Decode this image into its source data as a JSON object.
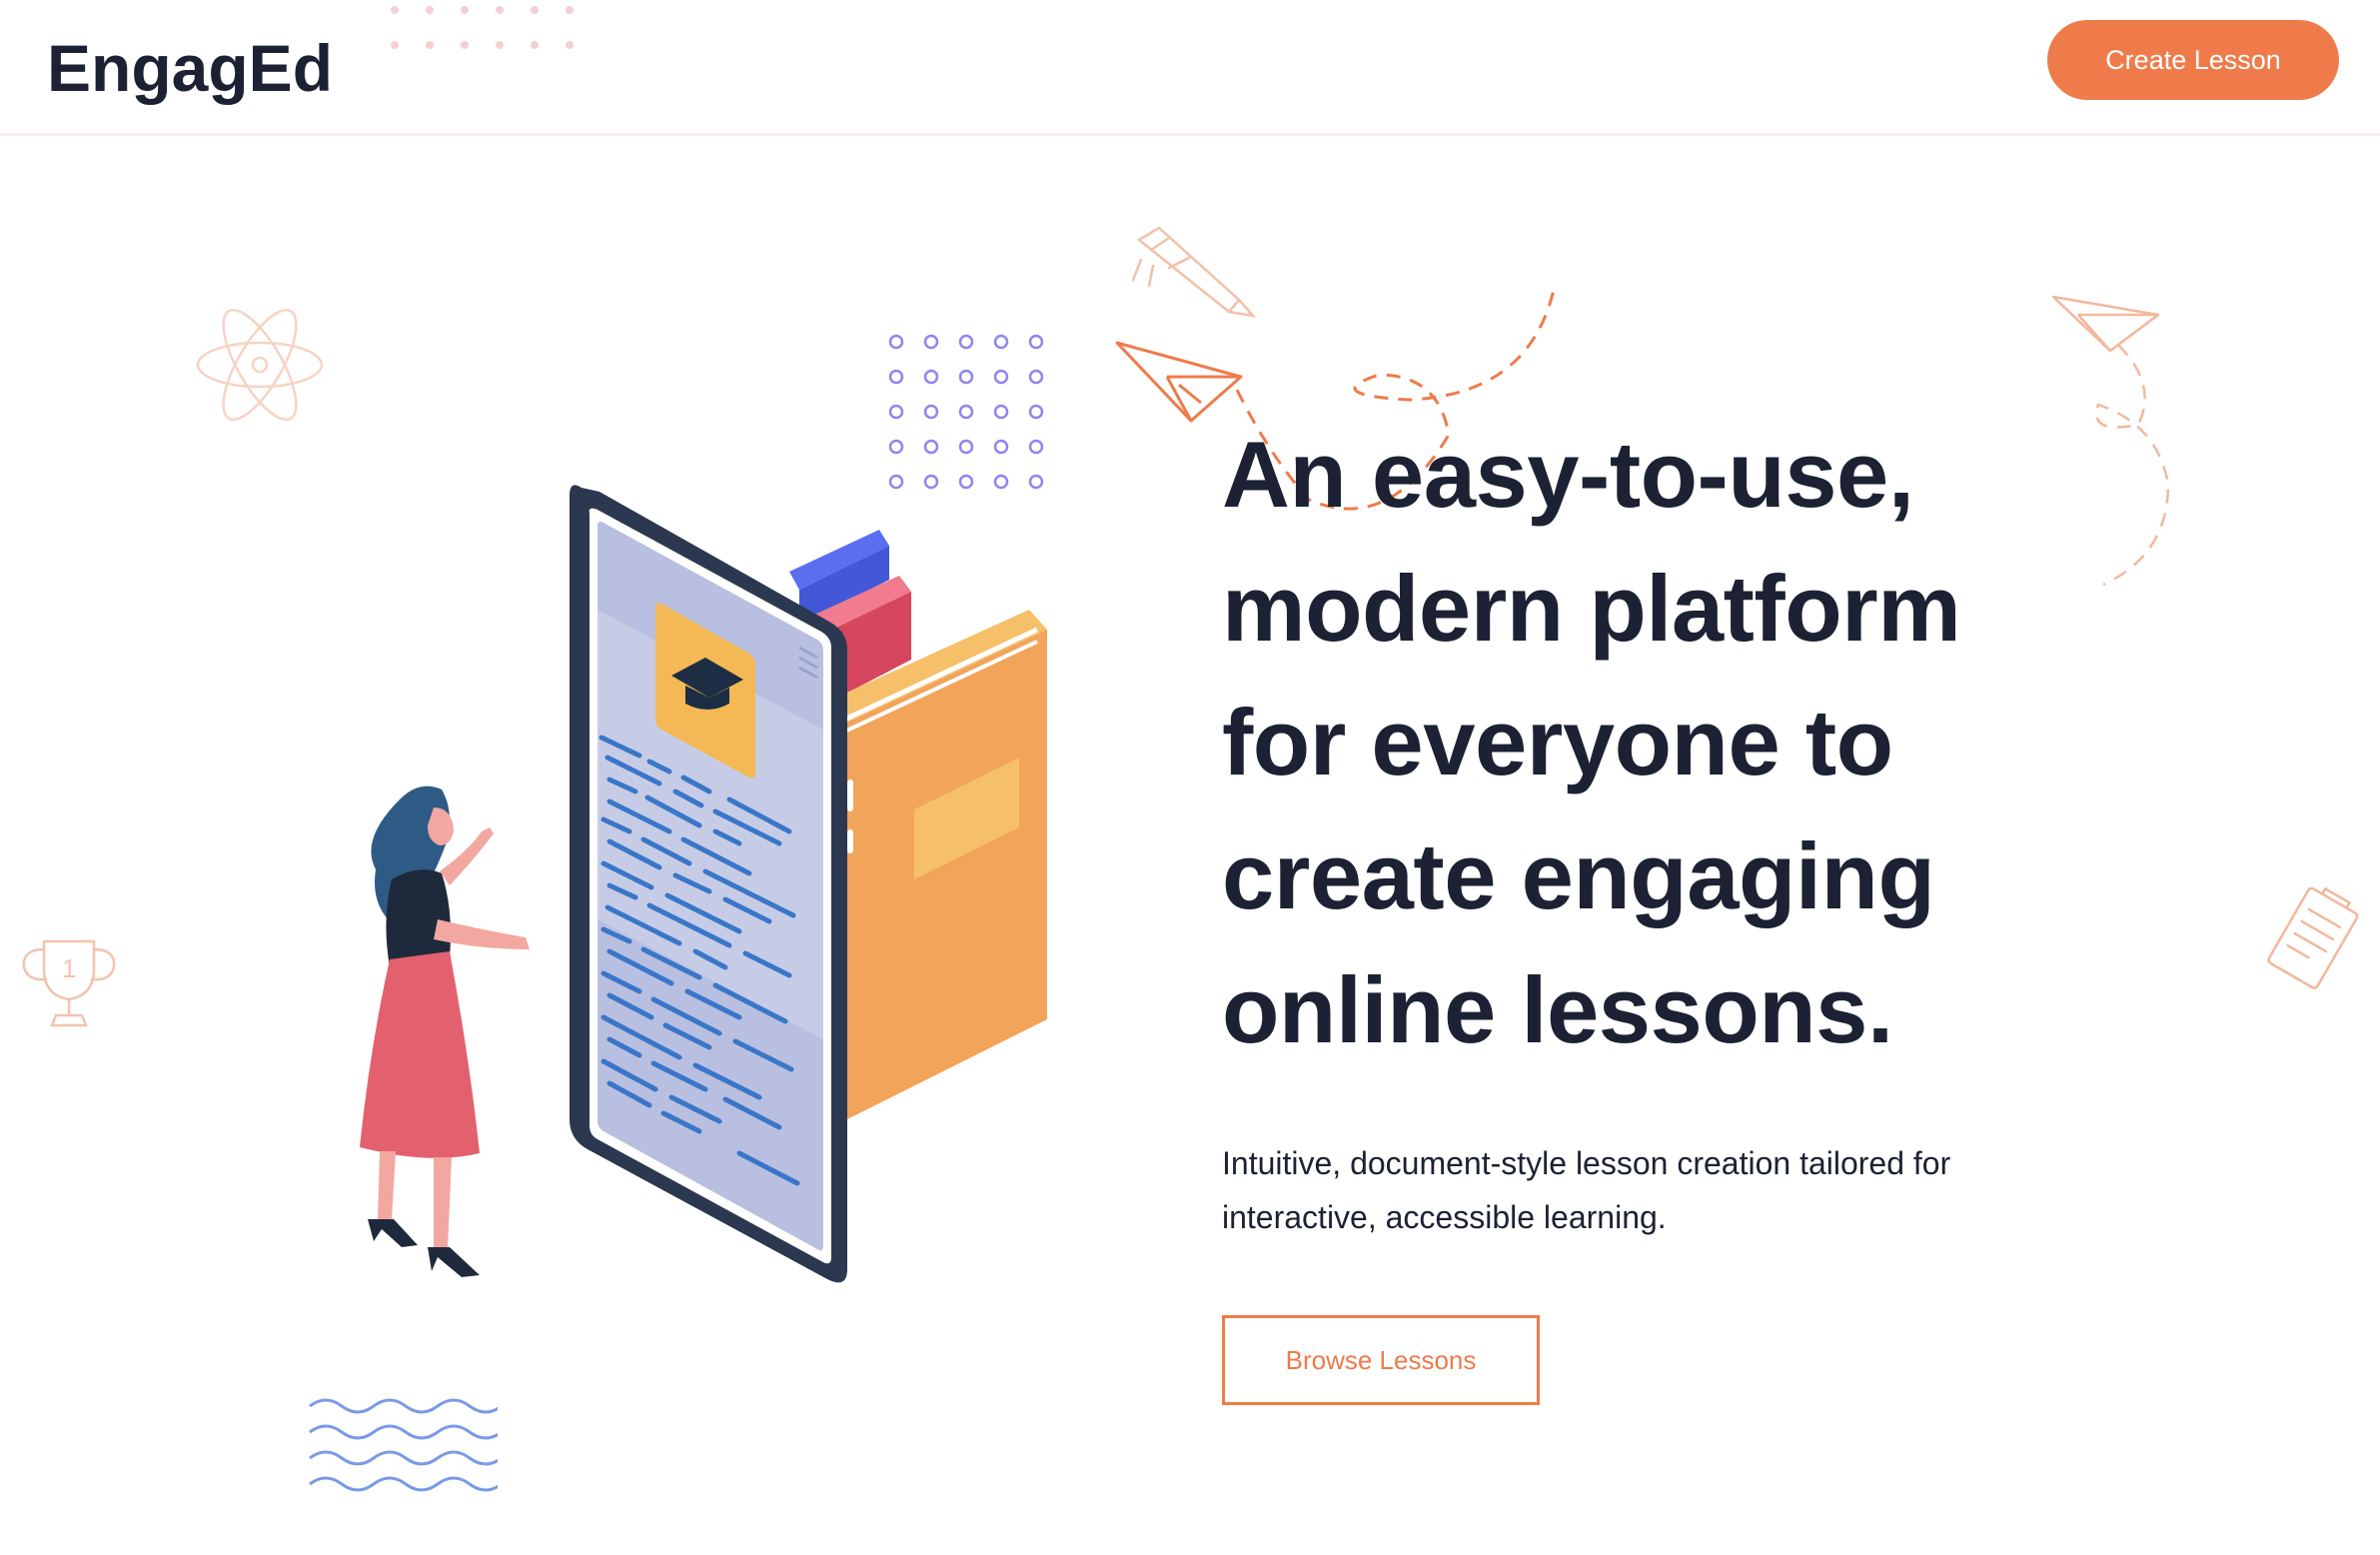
{
  "header": {
    "logo_text": "EngagEd",
    "create_label": "Create Lesson"
  },
  "hero": {
    "title_lines": [
      "An easy-to-use,",
      "modern platform",
      "for everyone to",
      "create engaging",
      "online lessons."
    ],
    "subtitle_lines": [
      "Intuitive, document-style lesson creation tailored for",
      "interactive, accessible learning."
    ],
    "browse_label": "Browse Lessons"
  },
  "colors": {
    "accent": "#ef7b4a",
    "text": "#1c2233",
    "divider": "#fbeee8"
  },
  "illustration": {
    "icons": [
      "graduation-cap-icon",
      "paper-plane-icon",
      "rocket-icon",
      "atom-icon",
      "trophy-icon",
      "document-icon"
    ]
  }
}
